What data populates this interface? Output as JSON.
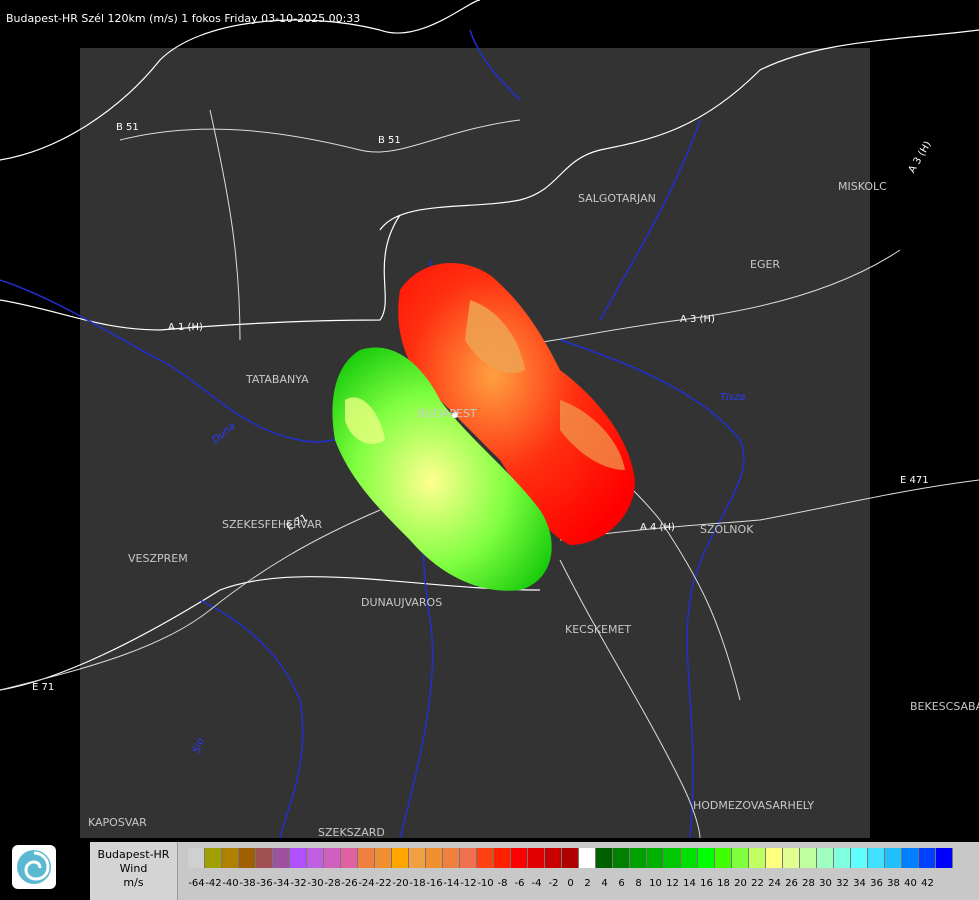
{
  "header": {
    "title": "Budapest-HR Szél 120km (m/s) 1 fokos Friday 03-10-2025 00:33"
  },
  "cities": [
    {
      "name": "SALGOTARJAN"
    },
    {
      "name": "MISKOLC"
    },
    {
      "name": "EGER"
    },
    {
      "name": "TATABANYA"
    },
    {
      "name": "BUDAPEST"
    },
    {
      "name": "SZEKESFEHERVAR"
    },
    {
      "name": "VESZPREM"
    },
    {
      "name": "DUNAUJVAROS"
    },
    {
      "name": "KECSKEMET"
    },
    {
      "name": "SZOLNOK"
    },
    {
      "name": "BEKESCSABA"
    },
    {
      "name": "HODMEZOVASARHELY"
    },
    {
      "name": "KAPOSVAR"
    },
    {
      "name": "SZEKSZARD"
    }
  ],
  "roads": [
    "B 51",
    "B 51",
    "A 3 (H)",
    "A 3 (H)",
    "A 1 (H)",
    "A 4 (H)",
    "E 71",
    "E 71",
    "E 471"
  ],
  "rivers": [
    "Tisza",
    "Duna",
    "Sio"
  ],
  "legend": {
    "title_line1": "Budapest-HR",
    "title_line2": "Wind",
    "title_line3": "m/s",
    "colors": [
      "#d0d0d0",
      "#a0a000",
      "#b08000",
      "#a06000",
      "#a05050",
      "#a050a0",
      "#b050ff",
      "#c060e0",
      "#d060c0",
      "#e060a0",
      "#f08040",
      "#f09030",
      "#ffa500",
      "#f0a040",
      "#f09030",
      "#f08040",
      "#f07050",
      "#ff4010",
      "#ff2000",
      "#ff0000",
      "#e00000",
      "#c80000",
      "#b00000",
      "#ffffff",
      "#006000",
      "#008000",
      "#00a000",
      "#00b000",
      "#00c800",
      "#00e000",
      "#00ff00",
      "#40ff00",
      "#80ff40",
      "#c0ff60",
      "#ffff80",
      "#e0ff90",
      "#c0ffa0",
      "#a0ffc0",
      "#80ffe0",
      "#60ffff",
      "#40e0ff",
      "#20c0ff",
      "#0080ff",
      "#0040ff",
      "#0000ff"
    ],
    "ticks": [
      "-64",
      "-42",
      "-40",
      "-38",
      "-36",
      "-34",
      "-32",
      "-30",
      "-28",
      "-26",
      "-24",
      "-22",
      "-20",
      "-18",
      "-16",
      "-14",
      "-12",
      "-10",
      "-8",
      "-6",
      "-4",
      "-2",
      "0",
      "2",
      "4",
      "6",
      "8",
      "10",
      "12",
      "14",
      "16",
      "18",
      "20",
      "22",
      "24",
      "26",
      "28",
      "30",
      "32",
      "34",
      "36",
      "38",
      "40",
      "42"
    ]
  }
}
